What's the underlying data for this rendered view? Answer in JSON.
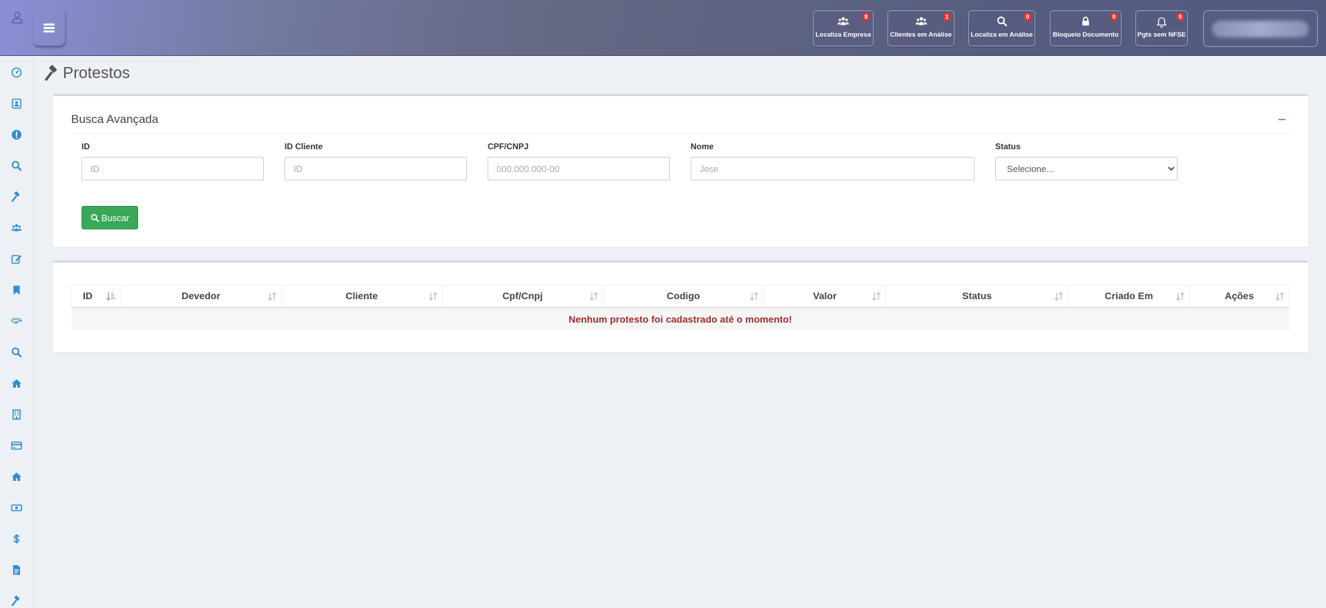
{
  "header": {
    "quick_actions": [
      {
        "label": "Localiza Empresa",
        "badge": "8",
        "icon": "users-icon"
      },
      {
        "label": "Clientes em Análise",
        "badge": "1",
        "icon": "users-icon"
      },
      {
        "label": "Localiza em Análise",
        "badge": "0",
        "icon": "search-icon"
      },
      {
        "label": "Bloqueio Documento",
        "badge": "0",
        "icon": "lock-icon"
      },
      {
        "label": "Pgts sem NFSE",
        "badge": "0",
        "icon": "bell-icon"
      }
    ]
  },
  "sidebar": {
    "items": [
      "dashboard-icon",
      "contact-card-icon",
      "alert-icon",
      "search-icon",
      "gavel-icon",
      "users-icon",
      "edit-icon",
      "bookmark-icon",
      "handshake-icon",
      "search-icon",
      "home-icon",
      "building-icon",
      "credit-card-icon",
      "home-icon",
      "money-icon",
      "dollar-icon",
      "document-icon",
      "gavel-icon"
    ],
    "icon_color": "#2f8fce"
  },
  "page": {
    "title": "Protestos"
  },
  "search_panel": {
    "title": "Busca Avançada",
    "fields": {
      "id": {
        "label": "ID",
        "placeholder": "ID"
      },
      "id_cliente": {
        "label": "ID Cliente",
        "placeholder": "ID"
      },
      "cpf_cnpj": {
        "label": "CPF/CNPJ",
        "placeholder": "000.000.000-00"
      },
      "nome": {
        "label": "Nome",
        "placeholder": "Jose"
      },
      "status": {
        "label": "Status",
        "selected": "Selecione..."
      }
    },
    "button_label": "Buscar"
  },
  "results_table": {
    "columns": [
      "ID",
      "Devedor",
      "Cliente",
      "Cpf/Cnpj",
      "Codigo",
      "Valor",
      "Status",
      "Criado Em",
      "Ações"
    ],
    "empty_message": "Nenhum protesto foi cadastrado até o momento!"
  },
  "colors": {
    "accent_green": "#3aa957",
    "badge_red": "#e0362f",
    "empty_message": "#9b2e2e"
  }
}
